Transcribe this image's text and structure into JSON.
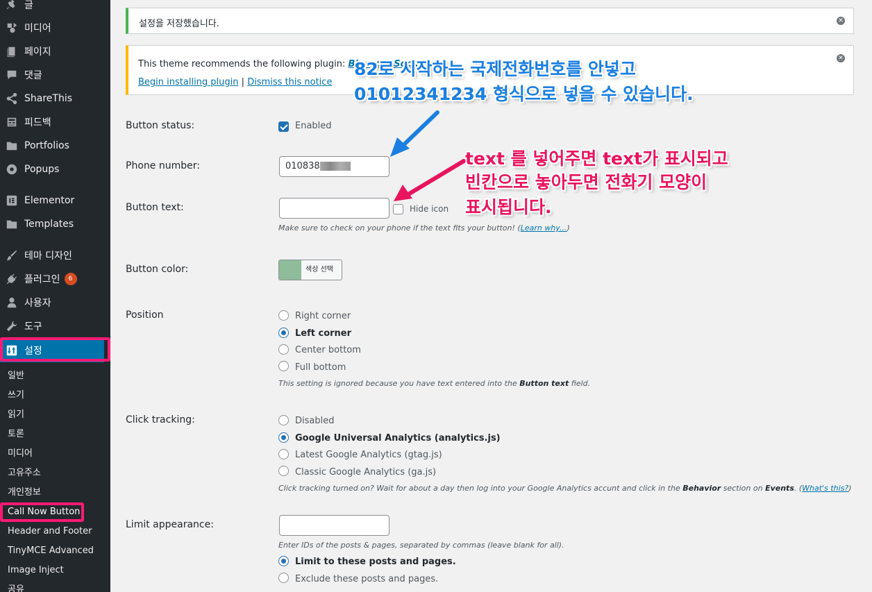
{
  "sidebar": {
    "items": [
      {
        "label": "글",
        "icon": "pin-icon"
      },
      {
        "label": "미디어",
        "icon": "media-icon"
      },
      {
        "label": "페이지",
        "icon": "page-icon"
      },
      {
        "label": "댓글",
        "icon": "comment-icon"
      },
      {
        "label": "ShareThis",
        "icon": "share-icon"
      },
      {
        "label": "피드백",
        "icon": "feedback-icon"
      },
      {
        "label": "Portfolios",
        "icon": "folder-icon"
      },
      {
        "label": "Popups",
        "icon": "popup-icon"
      },
      {
        "label": "Elementor",
        "icon": "elementor-icon"
      },
      {
        "label": "Templates",
        "icon": "folder-icon"
      },
      {
        "label": "테마 디자인",
        "icon": "brush-icon"
      },
      {
        "label": "플러그인",
        "icon": "plugin-icon",
        "badge": "6"
      },
      {
        "label": "사용자",
        "icon": "user-icon"
      },
      {
        "label": "도구",
        "icon": "wrench-icon"
      },
      {
        "label": "설정",
        "icon": "settings-icon",
        "current": true
      }
    ],
    "submenu": [
      "일반",
      "쓰기",
      "읽기",
      "토론",
      "미디어",
      "고유주소",
      "개인정보",
      "Call Now Button",
      "Header and Footer",
      "TinyMCE Advanced",
      "Image Inject",
      "공유"
    ]
  },
  "notices": {
    "saved": "설정을 저장했습니다.",
    "plugin_prefix": "This theme recommends the following plugin: ",
    "plugin_name": "Blossom Social",
    "install_link": "Begin installing plugin",
    "separator": "|",
    "dismiss_link": "Dismiss this notice",
    "dismiss_icon": "close-circle-icon"
  },
  "form": {
    "button_status": {
      "label": "Button status:",
      "checkbox_label": "Enabled",
      "checked": true
    },
    "phone_number": {
      "label": "Phone number:",
      "value": "010838"
    },
    "button_text": {
      "label": "Button text:",
      "value": "",
      "hide_icon_label": "Hide icon",
      "hint": "Make sure to check on your phone if the text fits your button! (",
      "hint_link": "Learn why...",
      "hint_end": ")"
    },
    "button_color": {
      "label": "Button color:",
      "button_label": "색상 선택",
      "color": "#8fbc9b"
    },
    "position": {
      "label": "Position",
      "options": [
        "Right corner",
        "Left corner",
        "Center bottom",
        "Full bottom"
      ],
      "selected": "Left corner",
      "note_prefix": "This setting is ignored because you have text entered into the ",
      "note_bold": "Button text",
      "note_suffix": " field."
    },
    "click_tracking": {
      "label": "Click tracking:",
      "options": [
        "Disabled",
        "Google Universal Analytics (analytics.js)",
        "Latest Google Analytics (gtag.js)",
        "Classic Google Analytics (ga.js)"
      ],
      "selected": "Google Universal Analytics (analytics.js)",
      "note_a": "Click tracking turned on? Wait for about a day then log into your Google Analytics accunt and click in the ",
      "note_b": "Behavior",
      "note_c": " section on ",
      "note_d": "Events",
      "note_e": ". (",
      "note_link": "What's this?",
      "note_f": ")"
    },
    "limit_appearance": {
      "label": "Limit appearance:",
      "value": "",
      "hint": "Enter IDs of the posts & pages, separated by commas (leave blank for all).",
      "options": [
        "Limit to these posts and pages.",
        "Exclude these posts and pages."
      ],
      "selected": "Limit to these posts and pages."
    }
  },
  "annotations": {
    "blue_line1": "82로 시작하는 국제전화번호를 안넣고",
    "blue_line2": "01012341234 형식으로 넣을 수 있습니다.",
    "pink_line1": "text 를 넣어주면 text가 표시되고",
    "pink_line2": "빈칸으로 놓아두면 전화기 모양이",
    "pink_line3": "표시됩니다.",
    "blue_color": "#1a7fe0",
    "pink_color": "#e8145e",
    "highlight_color": "#ff1a75"
  }
}
